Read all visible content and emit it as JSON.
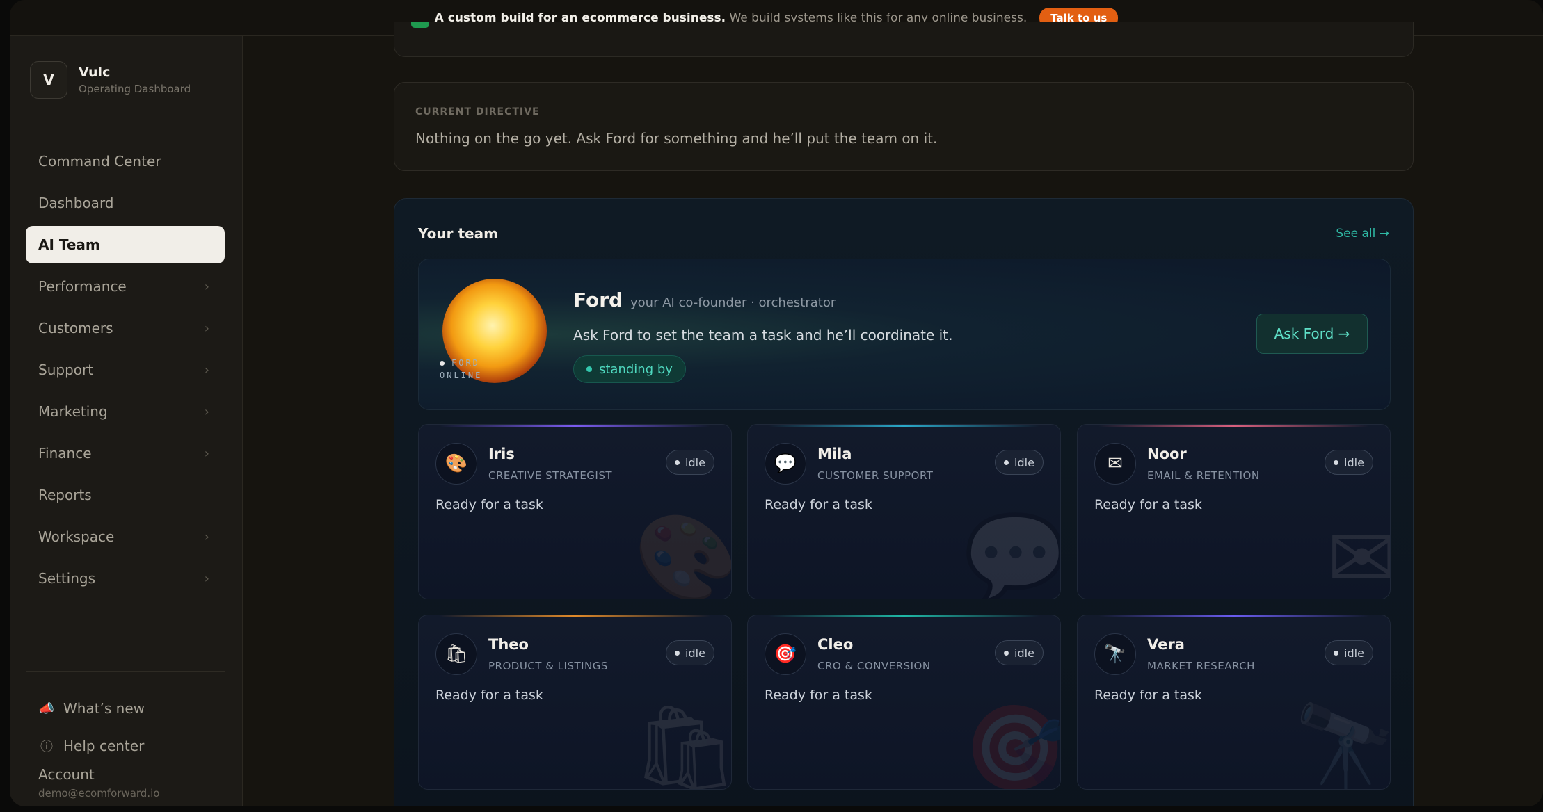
{
  "banner": {
    "bold": "A custom build for an ecommerce business.",
    "text": "We build systems like this for any online business.",
    "cta": "Talk to us"
  },
  "brand": {
    "logo": "V",
    "name": "Vulc",
    "subtitle": "Operating Dashboard"
  },
  "nav": {
    "items": [
      {
        "label": "Command Center",
        "chevron": false,
        "active": false
      },
      {
        "label": "Dashboard",
        "chevron": false,
        "active": false
      },
      {
        "label": "AI Team",
        "chevron": false,
        "active": true
      },
      {
        "label": "Performance",
        "chevron": true,
        "active": false
      },
      {
        "label": "Customers",
        "chevron": true,
        "active": false
      },
      {
        "label": "Support",
        "chevron": true,
        "active": false
      },
      {
        "label": "Marketing",
        "chevron": true,
        "active": false
      },
      {
        "label": "Finance",
        "chevron": true,
        "active": false
      },
      {
        "label": "Reports",
        "chevron": false,
        "active": false
      },
      {
        "label": "Workspace",
        "chevron": true,
        "active": false
      },
      {
        "label": "Settings",
        "chevron": true,
        "active": false
      }
    ],
    "chevron_glyph": "›"
  },
  "footer": {
    "whats_new": "What’s new",
    "help": "Help center",
    "account_label": "Account",
    "account_email": "demo@ecomforward.io"
  },
  "directive": {
    "label": "CURRENT DIRECTIVE",
    "text": "Nothing on the go yet. Ask Ford for something and he’ll put the team on it."
  },
  "team": {
    "title": "Your team",
    "see_all": "See all →",
    "ford": {
      "name": "Ford",
      "role": "your AI co-founder · orchestrator",
      "description": "Ask Ford to set the team a task and he’ll coordinate it.",
      "status": "standing by",
      "online_line1": "FORD",
      "online_line2": "ONLINE",
      "button": "Ask Ford →"
    },
    "members": [
      {
        "name": "Iris",
        "role": "CREATIVE STRATEGIST",
        "status": "idle",
        "message": "Ready for a task",
        "icon": "palette-icon",
        "glyph": "🎨",
        "accent": "#7b5cf0"
      },
      {
        "name": "Mila",
        "role": "CUSTOMER SUPPORT",
        "status": "idle",
        "message": "Ready for a task",
        "icon": "speech-bubble-icon",
        "glyph": "💬",
        "accent": "#2aa9c9"
      },
      {
        "name": "Noor",
        "role": "EMAIL & RETENTION",
        "status": "idle",
        "message": "Ready for a task",
        "icon": "envelope-icon",
        "glyph": "✉",
        "accent": "#d9607e"
      },
      {
        "name": "Theo",
        "role": "PRODUCT & LISTINGS",
        "status": "idle",
        "message": "Ready for a task",
        "icon": "shopping-bag-icon",
        "glyph": "🛍",
        "accent": "#e08a2a"
      },
      {
        "name": "Cleo",
        "role": "CRO & CONVERSION",
        "status": "idle",
        "message": "Ready for a task",
        "icon": "target-icon",
        "glyph": "🎯",
        "accent": "#1fb8a6"
      },
      {
        "name": "Vera",
        "role": "MARKET RESEARCH",
        "status": "idle",
        "message": "Ready for a task",
        "icon": "telescope-icon",
        "glyph": "🔭",
        "accent": "#6a5cf0"
      }
    ]
  }
}
